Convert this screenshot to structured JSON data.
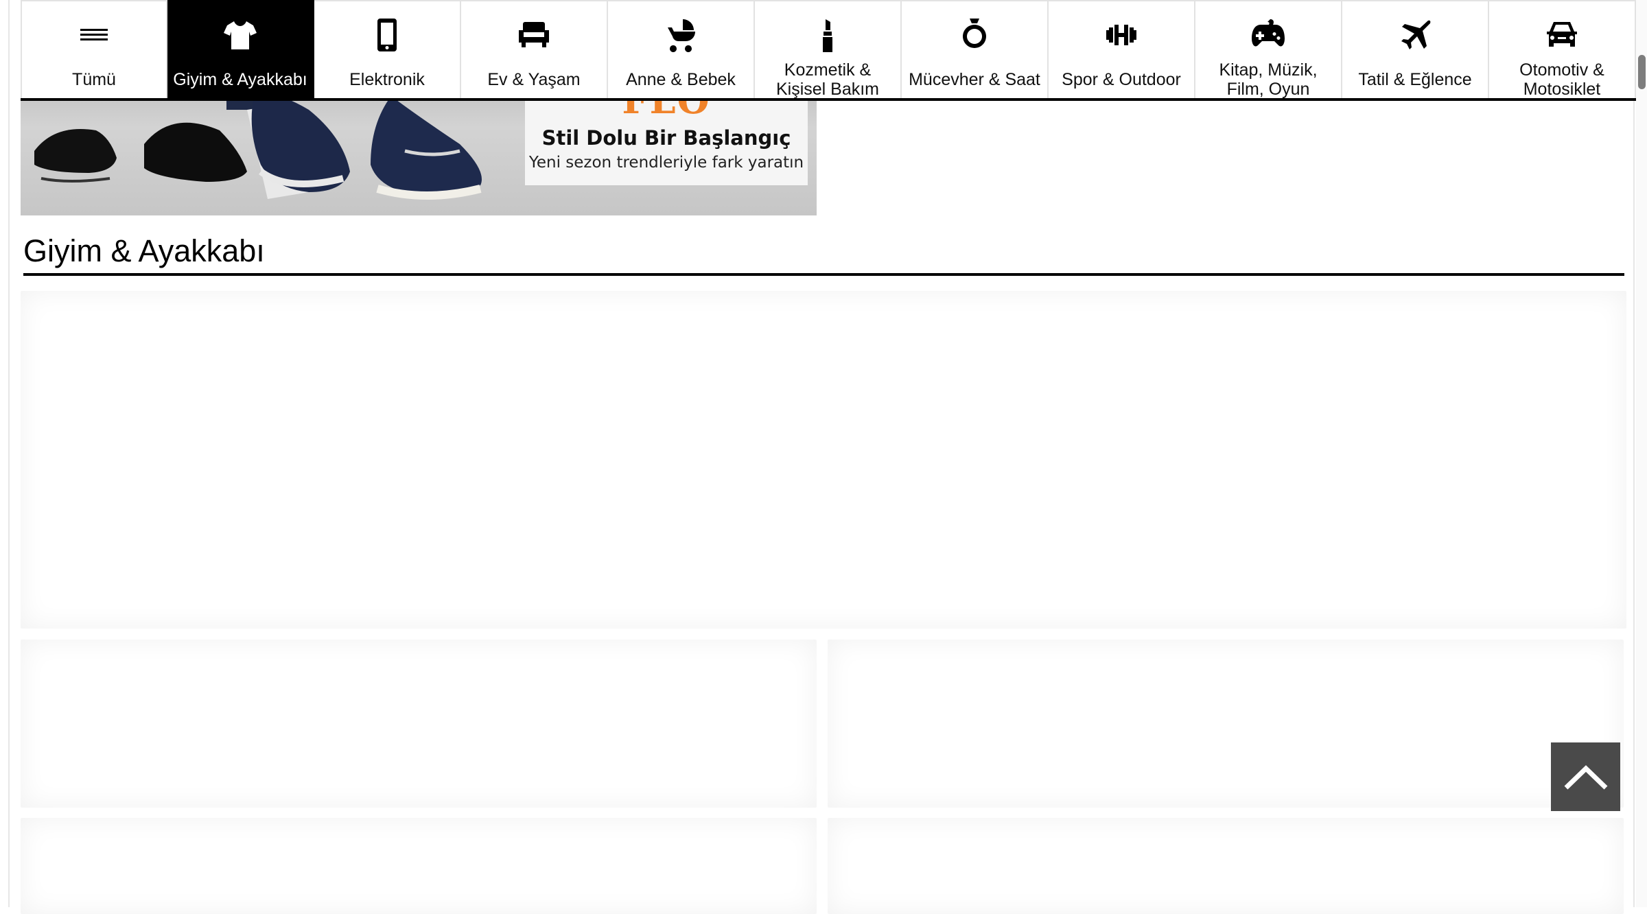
{
  "categories": [
    {
      "label": "Tümü",
      "icon": "menu-icon",
      "active": false
    },
    {
      "label": "Giyim & Ayakkabı",
      "icon": "tshirt-icon",
      "active": true
    },
    {
      "label": "Elektronik",
      "icon": "smartphone-icon",
      "active": false
    },
    {
      "label": "Ev & Yaşam",
      "icon": "armchair-icon",
      "active": false
    },
    {
      "label": "Anne & Bebek",
      "icon": "baby-stroller-icon",
      "active": false
    },
    {
      "label": "Kozmetik & Kişisel Bakım",
      "icon": "lipstick-icon",
      "active": false
    },
    {
      "label": "Mücevher & Saat",
      "icon": "ring-icon",
      "active": false
    },
    {
      "label": "Spor & Outdoor",
      "icon": "dumbbell-icon",
      "active": false
    },
    {
      "label": "Kitap, Müzik, Film, Oyun",
      "icon": "gamepad-icon",
      "active": false
    },
    {
      "label": "Tatil & Eğlence",
      "icon": "airplane-icon",
      "active": false
    },
    {
      "label": "Otomotiv & Motosiklet",
      "icon": "car-icon",
      "active": false
    }
  ],
  "banner": {
    "brand": "FLO",
    "title": "Stil Dolu Bir Başlangıç",
    "subtitle": "Yeni sezon trendleriyle fark yaratın",
    "brand_color": "#f0832a"
  },
  "section": {
    "title": "Giyim & Ayakkabı"
  },
  "colors": {
    "active_tab_bg": "#000000",
    "back_to_top_bg": "#4a4a4a"
  },
  "back_to_top_icon": "chevron-up-icon"
}
